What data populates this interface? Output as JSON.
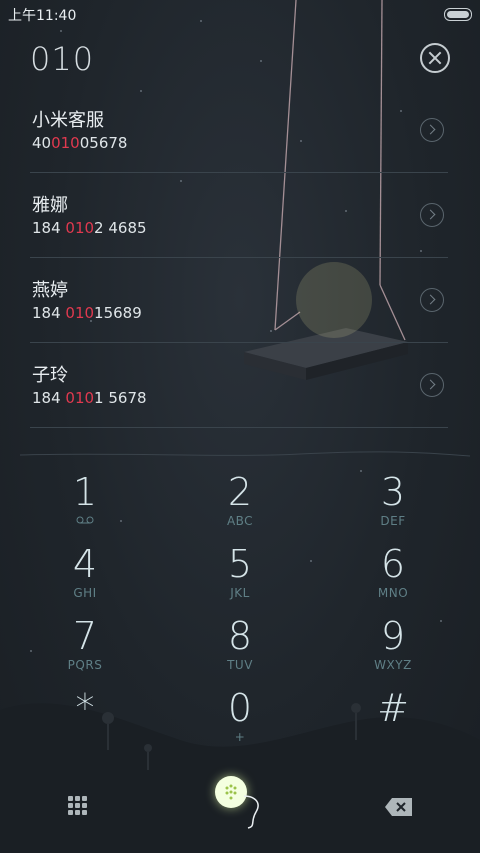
{
  "status_bar": {
    "time": "上午11:40"
  },
  "dialer": {
    "query": "010"
  },
  "contacts": [
    {
      "name": "小米客服",
      "num_pre": "40",
      "num_hl": "010",
      "num_post": "05678"
    },
    {
      "name": "雅娜",
      "num_pre": "184 ",
      "num_hl": "010",
      "num_post": "2 4685"
    },
    {
      "name": "燕婷",
      "num_pre": "184 ",
      "num_hl": "010",
      "num_post": "15689"
    },
    {
      "name": "子玲",
      "num_pre": "184 ",
      "num_hl": "010",
      "num_post": "1 5678"
    }
  ],
  "keypad": [
    {
      "digit": "1",
      "sub": ""
    },
    {
      "digit": "2",
      "sub": "ABC"
    },
    {
      "digit": "3",
      "sub": "DEF"
    },
    {
      "digit": "4",
      "sub": "GHI"
    },
    {
      "digit": "5",
      "sub": "JKL"
    },
    {
      "digit": "6",
      "sub": "MNO"
    },
    {
      "digit": "7",
      "sub": "PQRS"
    },
    {
      "digit": "8",
      "sub": "TUV"
    },
    {
      "digit": "9",
      "sub": "WXYZ"
    },
    {
      "digit": "*",
      "sub": ""
    },
    {
      "digit": "0",
      "sub": "+"
    },
    {
      "digit": "#",
      "sub": ""
    }
  ],
  "icons": {
    "voicemail": "voicemail-icon",
    "keypad_toggle": "keypad-grid-icon",
    "call": "call-icon",
    "backspace": "backspace-icon",
    "clear": "clear-icon"
  },
  "colors": {
    "highlight": "#e0394f",
    "accent_call": "#f4ffe0"
  }
}
